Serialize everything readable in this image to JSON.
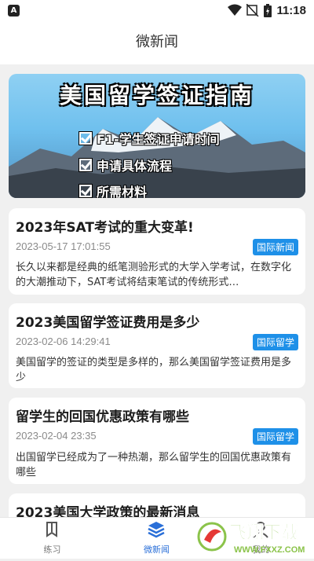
{
  "status": {
    "time": "11:18"
  },
  "appbar": {
    "title": "微新闻"
  },
  "banner": {
    "title": "美国留学签证指南",
    "items": [
      "F1-学生签证申请时间",
      "申请具体流程",
      "所需材料"
    ]
  },
  "articles": [
    {
      "title": "2023年SAT考试的重大变革!",
      "time": "2023-05-17 17:01:55",
      "tag": "国际新闻",
      "desc": "长久以来都是经典的纸笔测验形式的大学入学考试，在数字化的大潮推动下，SAT考试将结束笔试的传统形式…"
    },
    {
      "title": "2023美国留学签证费用是多少",
      "time": "2023-02-06 14:29:41",
      "tag": "国际留学",
      "desc": "美国留学的签证的类型是多样的，那么美国留学签证费用是多少"
    },
    {
      "title": "留学生的回国优惠政策有哪些",
      "time": "2023-02-04 23:35",
      "tag": "国际留学",
      "desc": "出国留学已经成为了一种热潮，那么留学生的回国优惠政策有哪些"
    },
    {
      "title": "2023美国大学政策的最新消息"
    }
  ],
  "nav": {
    "items": [
      {
        "label": "练习",
        "icon": "book-icon"
      },
      {
        "label": "微新闻",
        "icon": "layers-icon"
      },
      {
        "label": "我的",
        "icon": "user-icon"
      }
    ]
  },
  "watermark": {
    "text": "飞翔下载",
    "url": "WWW.FXXZ.COM"
  },
  "colors": {
    "accent": "#2a6fd8",
    "badge": "#1e90e8",
    "background": "#f0f0f0"
  }
}
